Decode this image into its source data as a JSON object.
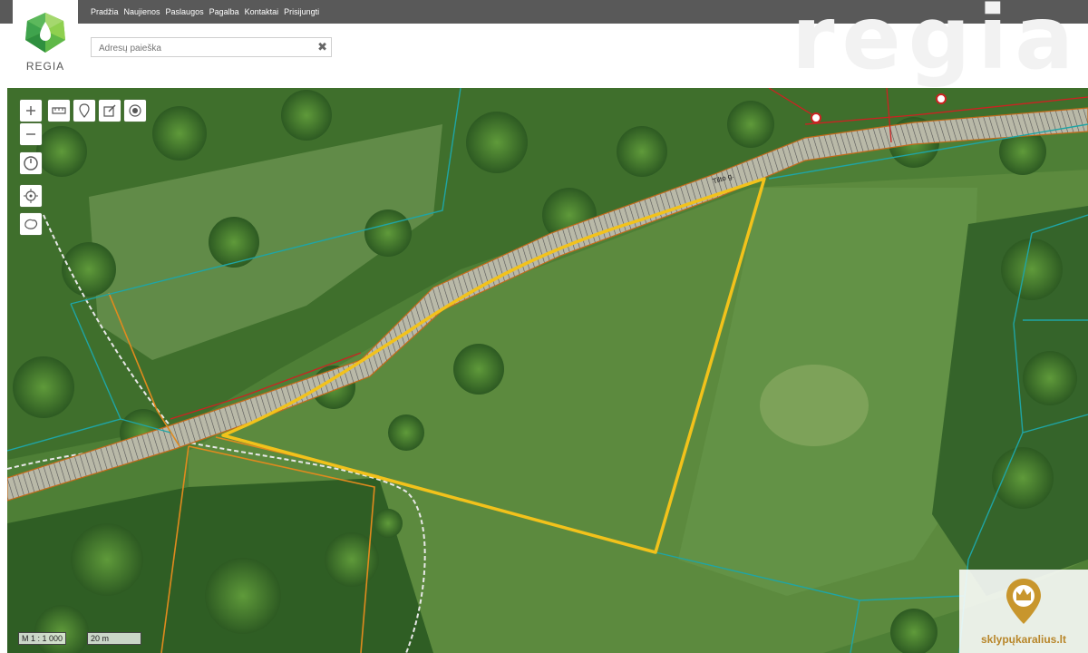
{
  "nav": {
    "items": [
      "Pradžia",
      "Naujienos",
      "Paslaugos",
      "Pagalba",
      "Kontaktai",
      "Prisijungti"
    ]
  },
  "header": {
    "logo_text": "REGIA",
    "watermark": "regia"
  },
  "search": {
    "placeholder": "Adresų paieška",
    "clear_icon": "close-icon"
  },
  "map": {
    "street_label": "Tilto g.",
    "scale_ratio": "M 1 : 1 000",
    "scale_bar": "20 m",
    "tools_left": [
      "zoom-in-icon",
      "zoom-out-icon",
      "history-icon",
      "locate-icon",
      "layers-icon"
    ],
    "tools_top": [
      "measure-icon",
      "marker-icon",
      "edit-icon",
      "target-icon"
    ],
    "colors": {
      "parcel_highlight": "#f2c21b",
      "cadastre_line": "#1fa5a5",
      "road_line": "#e08a1e",
      "red_line": "#cc2222"
    }
  },
  "watermark_brand": {
    "text": "sklypųkaralius.lt",
    "icon": "crown-pin-icon"
  }
}
